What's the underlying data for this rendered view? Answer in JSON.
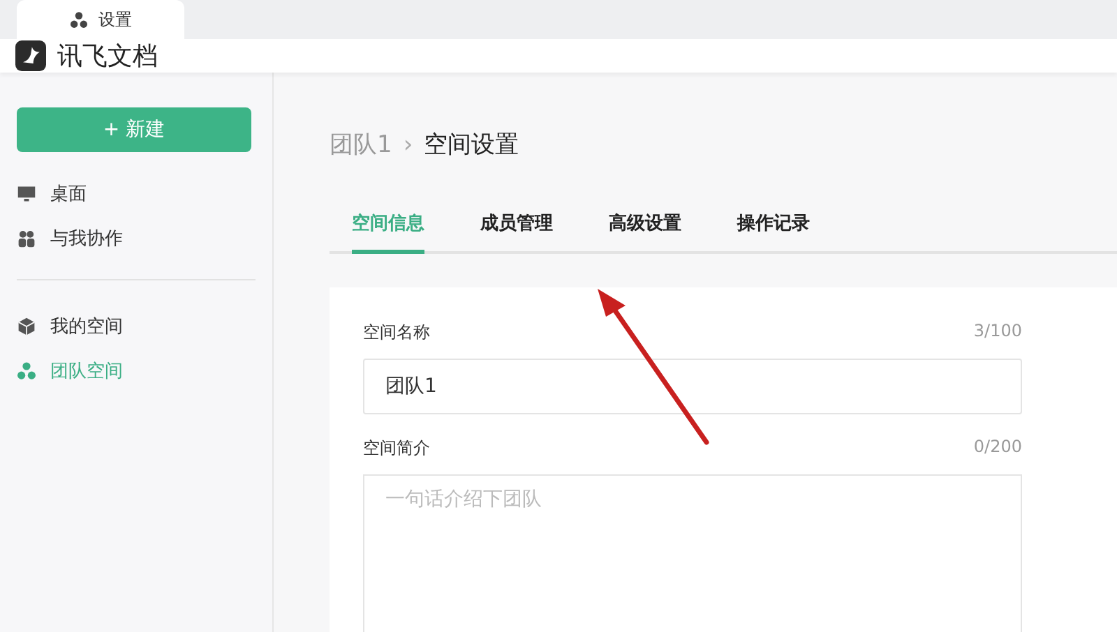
{
  "browser_tab": {
    "title": "设置"
  },
  "app": {
    "name": "讯飞文档"
  },
  "sidebar": {
    "new_button": {
      "icon": "+",
      "label": "新建"
    },
    "groups": [
      {
        "items": [
          {
            "label": "桌面",
            "kind": "desktop",
            "selected": false
          },
          {
            "label": "与我协作",
            "kind": "people",
            "selected": false
          }
        ]
      },
      {
        "items": [
          {
            "label": "我的空间",
            "kind": "cube",
            "selected": false
          },
          {
            "label": "团队空间",
            "kind": "team",
            "selected": true
          }
        ]
      }
    ]
  },
  "breadcrumb": {
    "parent": "团队1",
    "separator": "›",
    "current": "空间设置"
  },
  "tabs": [
    {
      "label": "空间信息",
      "selected": true
    },
    {
      "label": "成员管理",
      "selected": false
    },
    {
      "label": "高级设置",
      "selected": false
    },
    {
      "label": "操作记录",
      "selected": false
    }
  ],
  "form": {
    "name": {
      "label": "空间名称",
      "count": "3/100",
      "value": "团队1"
    },
    "description": {
      "label": "空间简介",
      "count": "0/200",
      "placeholder": "一句话介绍下团队"
    }
  }
}
